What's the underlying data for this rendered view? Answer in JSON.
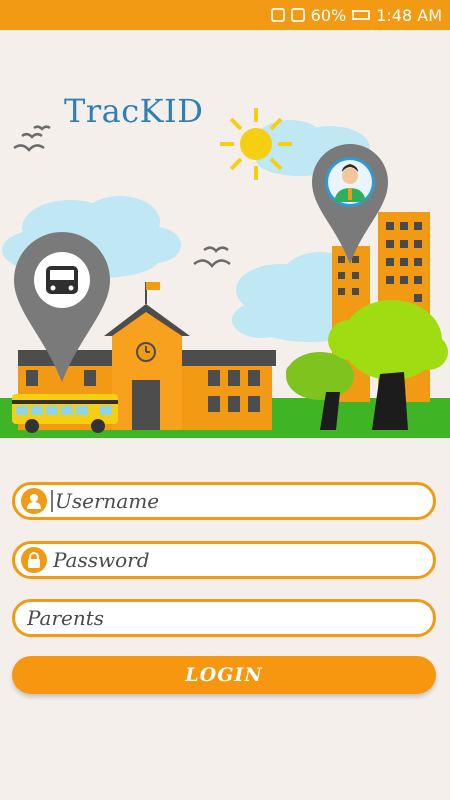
{
  "status_bar": {
    "battery": "60%",
    "time": "1:48 AM"
  },
  "app": {
    "title": "TracKID"
  },
  "login_form": {
    "username_placeholder": "Username",
    "password_placeholder": "Password",
    "role_placeholder": "Parents",
    "login_label": "LOGIN"
  },
  "colors": {
    "accent": "#f29a13",
    "title": "#2d7fb6",
    "background": "#f4efeb"
  }
}
